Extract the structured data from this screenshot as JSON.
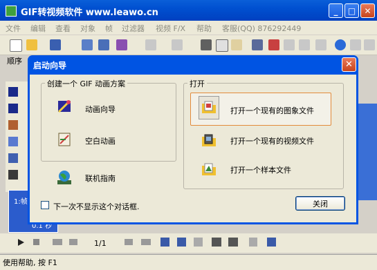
{
  "app": {
    "title": "GIF转视频软件 www.leawo.cn",
    "window_buttons": {
      "minimize": "_",
      "maximize": "□",
      "close": "✕"
    }
  },
  "menubar": {
    "items": [
      "文件",
      "编辑",
      "查看",
      "对象",
      "帧",
      "过滤器",
      "视频 F/X",
      "帮助",
      "客服(QQ) 876292449"
    ]
  },
  "sidebar": {
    "order_label": "顺序"
  },
  "frames": {
    "label": "1:帧",
    "time": "0.1 秒"
  },
  "playback": {
    "page": "1/1"
  },
  "status": {
    "text": "使用帮助, 按 F1"
  },
  "dialog": {
    "title": "启动向导",
    "create_group": {
      "label": "创建一个 GIF 动画方案",
      "items": [
        {
          "label": "动画向导",
          "icon": "wizard-icon"
        },
        {
          "label": "空白动画",
          "icon": "blank-animation-icon"
        }
      ]
    },
    "online_guide": {
      "label": "联机指南",
      "icon": "globe-icon"
    },
    "open_group": {
      "label": "打开",
      "items": [
        {
          "label": "打开一个现有的图象文件",
          "icon": "image-folder-icon"
        },
        {
          "label": "打开一个现有的视频文件",
          "icon": "video-folder-icon"
        },
        {
          "label": "打开一个样本文件",
          "icon": "sample-folder-icon"
        }
      ]
    },
    "checkbox_label": "下一次不显示这个对话框.",
    "close_button": "关闭",
    "title_close": "✕"
  },
  "colors": {
    "titlebar": "#0a5fd8",
    "dialog_frame": "#0054e3",
    "highlight_border": "#e28a3a"
  }
}
